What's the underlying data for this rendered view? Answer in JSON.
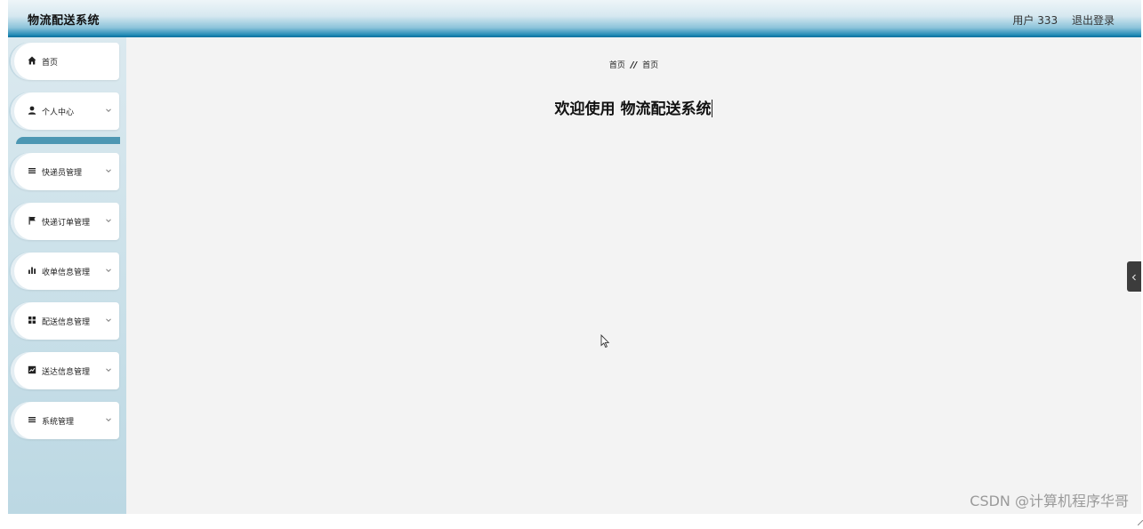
{
  "header": {
    "brand": "物流配送系统",
    "user": "用户 333",
    "logout": "退出登录"
  },
  "sidebar": {
    "items": [
      {
        "label": "首页",
        "icon": "home-icon"
      },
      {
        "label": "个人中心",
        "icon": "user-icon"
      },
      {
        "label": "快递员管理",
        "icon": "list-icon"
      },
      {
        "label": "快递订单管理",
        "icon": "flag-icon"
      },
      {
        "label": "收单信息管理",
        "icon": "bar-chart-icon"
      },
      {
        "label": "配送信息管理",
        "icon": "grid-icon"
      },
      {
        "label": "送达信息管理",
        "icon": "chart-box-icon"
      },
      {
        "label": "系统管理",
        "icon": "list-icon"
      }
    ]
  },
  "main": {
    "breadcrumb": {
      "first": "首页",
      "separator": "//",
      "current": "首页"
    },
    "welcome": "欢迎使用 物流配送系统"
  },
  "watermark": "CSDN @计算机程序华哥",
  "colors": {
    "header_accent": "#1b86b3",
    "sidebar_bg": "#c8dfe8",
    "separator": "#4d97b3",
    "main_bg": "#f3f3f3"
  }
}
